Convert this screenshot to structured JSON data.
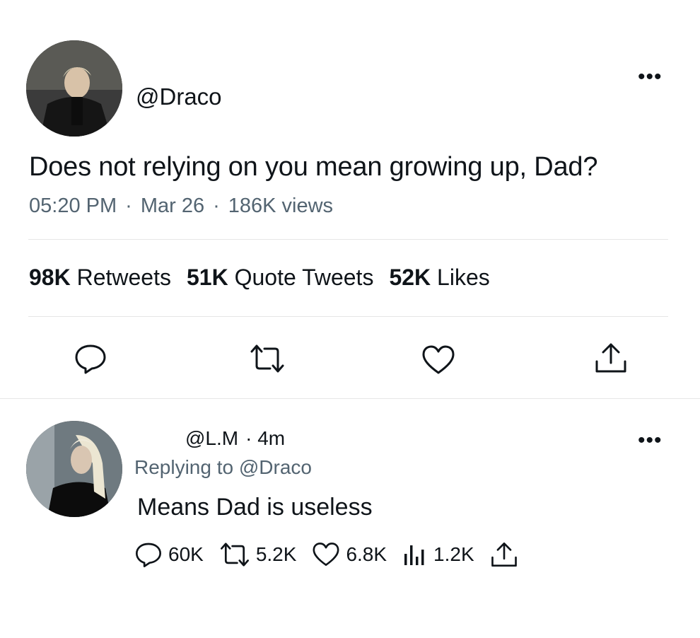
{
  "tweet": {
    "handle": "@Draco",
    "text": "Does not relying on you mean growing up, Dad?",
    "time": "05:20 PM",
    "date": "Mar 26",
    "views": "186K views",
    "more": "•••",
    "stats": {
      "retweets_count": "98K",
      "retweets_label": "Retweets",
      "quotes_count": "51K",
      "quotes_label": "Quote Tweets",
      "likes_count": "52K",
      "likes_label": "Likes"
    },
    "actions": [
      "reply-icon",
      "retweet-icon",
      "like-icon",
      "share-icon"
    ]
  },
  "reply": {
    "handle": "@L.M",
    "time": "· 4m",
    "replying_prefix": "Replying to",
    "replying_handle": "@Draco",
    "text": "Means Dad is useless",
    "more": "•••",
    "actions": {
      "replies": "60K",
      "retweets": "5.2K",
      "likes": "6.8K",
      "views": "1.2K"
    }
  },
  "colors": {
    "text": "#0f1419",
    "secondary": "#536471",
    "divider": "#e6e6e6"
  }
}
